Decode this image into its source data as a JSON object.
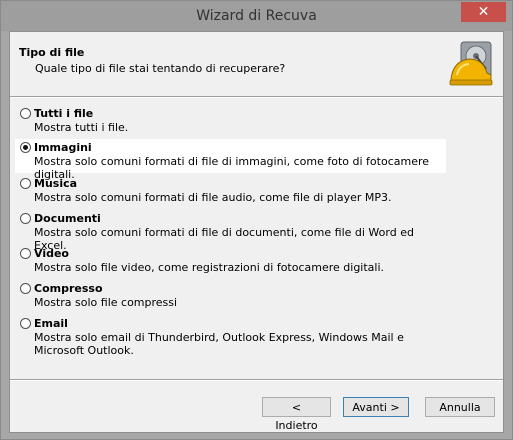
{
  "window": {
    "title": "Wizard di Recuva",
    "close_glyph": "✕"
  },
  "header": {
    "title": "Tipo di file",
    "subtitle": "Quale tipo di file stai tentando di recuperare?",
    "icon": "hard-drive-helmet-icon"
  },
  "options": [
    {
      "label": "Tutti i file",
      "desc": "Mostra tutti i file.",
      "checked": false
    },
    {
      "label": "Immagini",
      "desc": "Mostra solo comuni formati di file di immagini, come foto di fotocamere digitali.",
      "checked": true
    },
    {
      "label": "Musica",
      "desc": "Mostra solo comuni formati di file audio, come file di player MP3.",
      "checked": false
    },
    {
      "label": "Documenti",
      "desc": "Mostra solo comuni formati di file di documenti, come file di Word ed Excel.",
      "checked": false
    },
    {
      "label": "Video",
      "desc": "Mostra solo file video, come registrazioni di fotocamere digitali.",
      "checked": false
    },
    {
      "label": "Compresso",
      "desc": "Mostra solo file compressi",
      "checked": false
    },
    {
      "label": "Email",
      "desc": "Mostra solo email di Thunderbird, Outlook Express, Windows Mail e Microsoft Outlook.",
      "checked": false
    }
  ],
  "buttons": {
    "back": "< Indietro",
    "next": "Avanti >",
    "cancel": "Annulla"
  },
  "colors": {
    "titlebar": "#9e9e9e",
    "close": "#c7504b",
    "client": "#f0f0f0",
    "selected": "#ffffff"
  }
}
